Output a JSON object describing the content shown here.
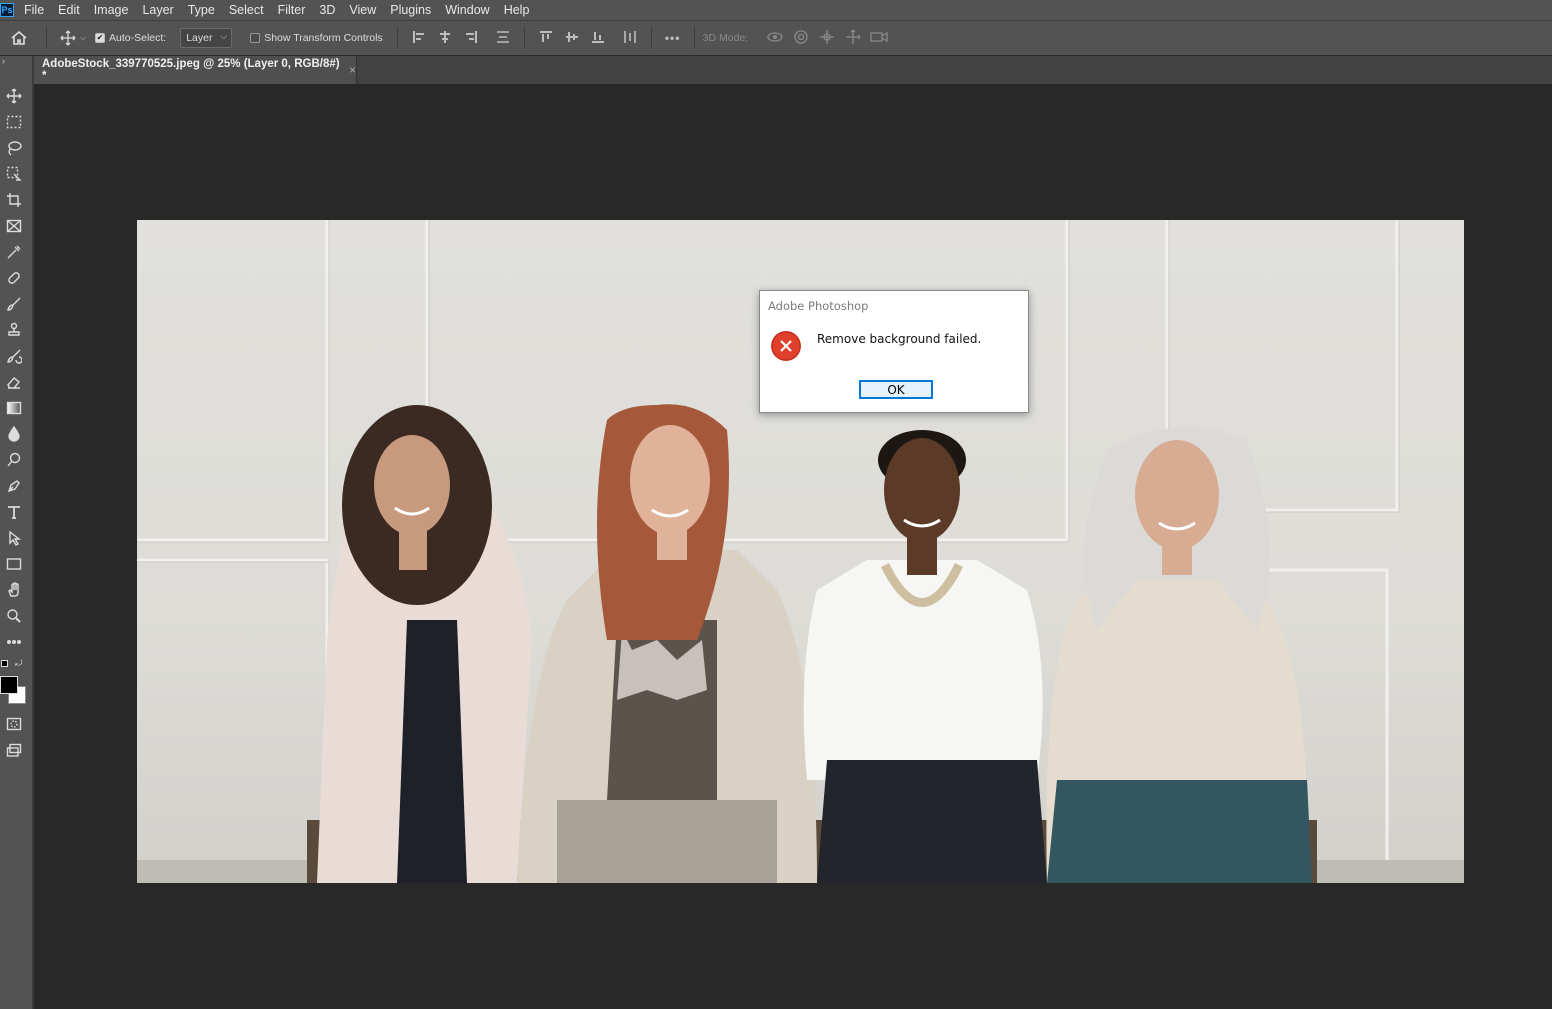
{
  "app": {
    "logo": "Ps"
  },
  "menu": [
    "File",
    "Edit",
    "Image",
    "Layer",
    "Type",
    "Select",
    "Filter",
    "3D",
    "View",
    "Plugins",
    "Window",
    "Help"
  ],
  "options_bar": {
    "auto_select_label": "Auto-Select:",
    "auto_select_checked": true,
    "auto_select_target": "Layer",
    "show_transform_label": "Show Transform Controls",
    "show_transform_checked": false,
    "more_label": "•••",
    "mode_3d_label": "3D Mode:"
  },
  "document_tab": {
    "title": "AdobeStock_339770525.jpeg @ 25% (Layer 0, RGB/8#) *",
    "close": "×"
  },
  "toolbar": {
    "tools": [
      "move-tool",
      "rectangular-marquee-tool",
      "lasso-tool",
      "object-selection-tool",
      "crop-tool",
      "frame-tool",
      "eyedropper-tool",
      "spot-healing-tool",
      "brush-tool",
      "clone-stamp-tool",
      "history-brush-tool",
      "eraser-tool",
      "gradient-tool",
      "blur-tool",
      "dodge-tool",
      "pen-tool",
      "type-tool",
      "path-selection-tool",
      "rectangle-tool",
      "hand-tool",
      "zoom-tool",
      "edit-toolbar"
    ],
    "foreground_color": "#000000",
    "background_color": "#ffffff"
  },
  "dialog": {
    "title": "Adobe Photoshop",
    "message": "Remove background failed.",
    "ok_label": "OK",
    "icon": "error-icon"
  },
  "colors": {
    "ui_panel": "#535353",
    "canvas_bg": "#282828",
    "error_red": "#e0402b",
    "accent_blue": "#0078d7"
  }
}
